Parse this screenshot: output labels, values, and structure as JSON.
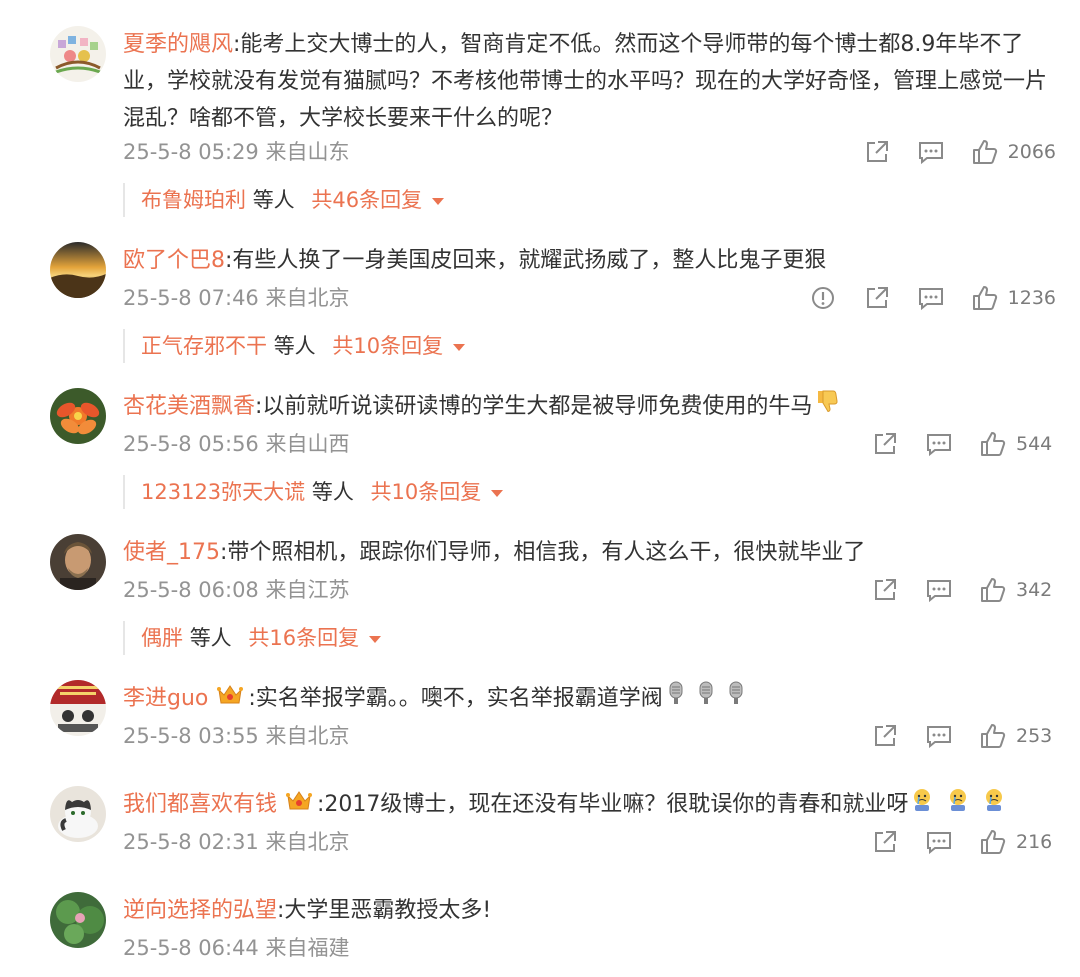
{
  "comments": [
    {
      "user": "夏季的飓风",
      "text": ":能考上交大博士的人，智商肯定不低。然而这个导师带的每个博士都8.9年毕不了业，学校就没有发觉有猫腻吗？不考核他带博士的水平吗？现在的大学好奇怪，管理上感觉一片混乱？啥都不管，大学校长要来干什么的呢？",
      "time": "25-5-8 05:29 来自山东",
      "likes": "2066",
      "reply_user": "布鲁姆珀利",
      "reply_etc": "等人",
      "reply_more": "共46条回复"
    },
    {
      "user": "欧了个巴8",
      "text": ":有些人换了一身美国皮回来，就耀武扬威了，整人比鬼子更狠",
      "time": "25-5-8 07:46 来自北京",
      "likes": "1236",
      "reply_user": "正气存邪不干",
      "reply_etc": "等人",
      "reply_more": "共10条回复"
    },
    {
      "user": "杏花美酒飘香",
      "text": ":以前就听说读研读博的学生大都是被导师免费使用的牛马",
      "time": "25-5-8 05:56 来自山西",
      "likes": "544",
      "reply_user": "123123弥天大谎",
      "reply_etc": "等人",
      "reply_more": "共10条回复"
    },
    {
      "user": "使者_175",
      "text": ":带个照相机，跟踪你们导师，相信我，有人这么干，很快就毕业了",
      "time": "25-5-8 06:08 来自江苏",
      "likes": "342",
      "reply_user": "偶胖",
      "reply_etc": "等人",
      "reply_more": "共16条回复"
    },
    {
      "user": "李进guo",
      "text": ":实名举报学霸。。噢不，实名举报霸道学阀",
      "time": "25-5-8 03:55 来自北京",
      "likes": "253"
    },
    {
      "user": "我们都喜欢有钱",
      "text": ":2017级博士，现在还没有毕业嘛？很耽误你的青春和就业呀",
      "time": "25-5-8 02:31 来自北京",
      "likes": "216"
    },
    {
      "user": "逆向选择的弘望",
      "text": ":大学里恶霸教授太多!",
      "time": "25-5-8 06:44 来自福建"
    }
  ],
  "icons": {
    "share": "share-icon",
    "comment": "comment-icon",
    "like": "thumbs-up-icon",
    "report": "report-icon"
  },
  "colors": {
    "username": "#eb7350",
    "meta": "#939393"
  }
}
